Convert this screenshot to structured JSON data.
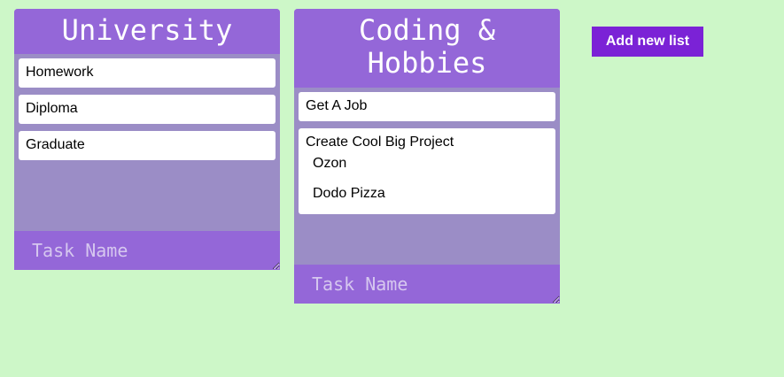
{
  "lists": [
    {
      "title": "University",
      "tasks": [
        {
          "label": "Homework"
        },
        {
          "label": "Diploma"
        },
        {
          "label": "Graduate"
        }
      ],
      "input_placeholder": "Task Name"
    },
    {
      "title": "Coding &\nHobbies",
      "tasks": [
        {
          "label": "Get A Job"
        },
        {
          "label": "Create Cool Big Project",
          "subtasks": [
            "Ozon",
            "Dodo Pizza"
          ]
        }
      ],
      "input_placeholder": "Task Name"
    }
  ],
  "add_list_label": "Add new list",
  "colors": {
    "background": "#cdf7c8",
    "list_header": "#9467d8",
    "list_body": "#9b8dc6",
    "card": "#ffffff",
    "add_button": "#7b22d6"
  }
}
